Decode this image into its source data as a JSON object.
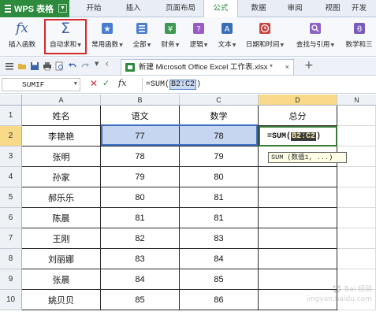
{
  "app": {
    "name": "WPS 表格",
    "brand_color": "#2e8b3e"
  },
  "tabs": [
    {
      "label": "开始",
      "active": false
    },
    {
      "label": "插入",
      "active": false
    },
    {
      "label": "页面布局",
      "active": false
    },
    {
      "label": "公式",
      "active": true
    },
    {
      "label": "数据",
      "active": false
    },
    {
      "label": "审阅",
      "active": false
    },
    {
      "label": "视图",
      "active": false
    },
    {
      "label": "开发",
      "active": false
    }
  ],
  "ribbon": {
    "insert_function": "插入函数",
    "autosum": "自动求和",
    "common_functions": "常用函数",
    "all": "全部",
    "financial": "财务",
    "logical": "逻辑",
    "text": "文本",
    "datetime": "日期和时间",
    "lookup": "查找与引用",
    "math": "数学和三"
  },
  "document_tab": {
    "title": "新建 Microsoft Office Excel 工作表.xlsx *",
    "close": "×"
  },
  "formula_bar": {
    "name_box": "SUMIF",
    "fx": "fx",
    "formula_prefix": "=SUM(",
    "formula_ref": "B2:C2",
    "formula_suffix": ")"
  },
  "sheet": {
    "columns": [
      "A",
      "B",
      "C",
      "D",
      "N"
    ],
    "row_numbers": [
      "1",
      "2",
      "3",
      "4",
      "5",
      "6",
      "7",
      "8",
      "9",
      "10"
    ],
    "header": {
      "name": "姓名",
      "chinese": "语文",
      "math": "数学",
      "total": "总分"
    },
    "rows": [
      {
        "name": "李艳艳",
        "chinese": "77",
        "math": "78"
      },
      {
        "name": "张明",
        "chinese": "78",
        "math": "79"
      },
      {
        "name": "孙家",
        "chinese": "79",
        "math": "80"
      },
      {
        "name": "郝乐乐",
        "chinese": "80",
        "math": "81"
      },
      {
        "name": "陈晨",
        "chinese": "81",
        "math": "81"
      },
      {
        "name": "王刚",
        "chinese": "82",
        "math": "83"
      },
      {
        "name": "刘丽娜",
        "chinese": "83",
        "math": "84"
      },
      {
        "name": "张晨",
        "chinese": "84",
        "math": "85"
      },
      {
        "name": "姚贝贝",
        "chinese": "85",
        "math": "86"
      }
    ],
    "editing_cell": {
      "prefix": "=SUM(",
      "ref": "B2:C2",
      "suffix": ")"
    },
    "tooltip": "SUM (数值1, ...)"
  },
  "watermark": "Bai 经验\njingyan.baidu.com"
}
